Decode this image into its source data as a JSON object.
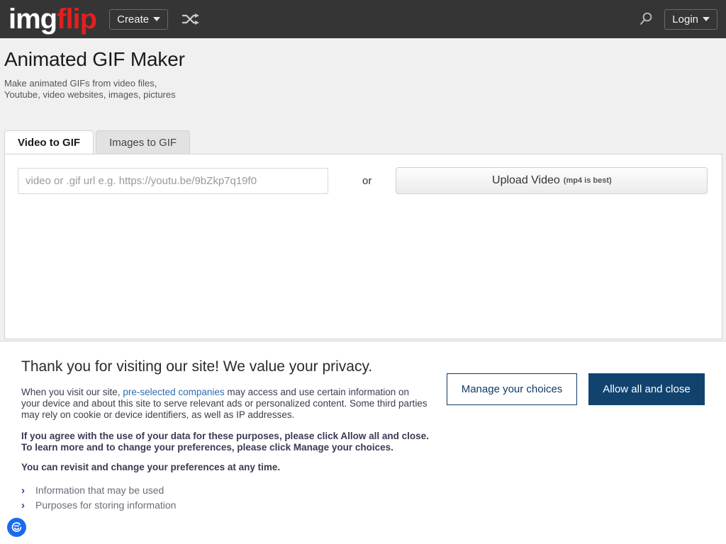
{
  "nav": {
    "logo_img": "img",
    "logo_flip": "flip",
    "create_label": "Create",
    "shuffle_icon": "shuffle-icon",
    "search_icon": "search-icon",
    "login_label": "Login"
  },
  "header": {
    "title": "Animated GIF Maker",
    "subtitle_line1": "Make animated GIFs from video files,",
    "subtitle_line2": "Youtube, video websites, images, pictures"
  },
  "tabs": [
    {
      "label": "Video to GIF",
      "active": true
    },
    {
      "label": "Images to GIF",
      "active": false
    }
  ],
  "main": {
    "url_value": "",
    "url_placeholder": "video or .gif url e.g. https://youtu.be/9bZkp7q19f0",
    "or_text": "or",
    "upload_label": "Upload Video",
    "upload_hint": "(mp4 is best)"
  },
  "privacy": {
    "title": "Thank you for visiting our site! We value your privacy.",
    "body_before_link": "When you visit our site, ",
    "body_link": "pre-selected companies",
    "body_after_link": " may access and use certain information on your device and about this site to serve relevant ads or personalized content. Some third parties may rely on cookie or device identifiers, as well as IP addresses.",
    "strong_1": "If you agree with the use of your data for these purposes, please click Allow all and close. To learn more and to change your preferences, please click Manage your choices.",
    "strong_2": "You can revisit and change your preferences at any time.",
    "disclosures": [
      "Information that may be used",
      "Purposes for storing information"
    ],
    "manage_label": "Manage your choices",
    "allow_label": "Allow all and close",
    "accent_navy": "#12436f",
    "link_blue": "#2f6bb0",
    "badge_blue": "#1a6aef",
    "badge_icon": "consent-shield-icon"
  }
}
